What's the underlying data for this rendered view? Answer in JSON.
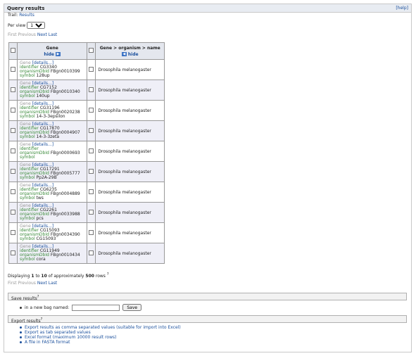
{
  "panel": {
    "title": "Query results",
    "help_label": "[help]"
  },
  "trail": {
    "prefix": "Trail:",
    "link": "Results"
  },
  "per_view": {
    "label": "Per view",
    "value": "10"
  },
  "pager": {
    "first": "First",
    "previous": "Previous",
    "next": "Next",
    "last": "Last"
  },
  "columns": {
    "gene": {
      "title": "Gene",
      "hide": "hide"
    },
    "organism": {
      "title": "Gene > organism > name",
      "hide": "hide"
    }
  },
  "rows": [
    {
      "cls": "Gene",
      "details": "[details...]",
      "identifier": "CG3340",
      "organism_db_id": "FBgn0010399",
      "symbol": "128up",
      "organism": "Drosophila melanogaster"
    },
    {
      "cls": "Gene",
      "details": "[details...]",
      "identifier": "CG7152",
      "organism_db_id": "FBgn0010340",
      "symbol": "140up",
      "organism": "Drosophila melanogaster"
    },
    {
      "cls": "Gene",
      "details": "[details...]",
      "identifier": "CG31196",
      "organism_db_id": "FBgn0020238",
      "symbol": "14-3-3epsilon",
      "organism": "Drosophila melanogaster"
    },
    {
      "cls": "Gene",
      "details": "[details...]",
      "identifier": "CG17870",
      "organism_db_id": "FBgn0004907",
      "symbol": "14-3-3zeta",
      "organism": "Drosophila melanogaster"
    },
    {
      "cls": "Gene",
      "details": "[details...]",
      "identifier": "",
      "organism_db_id": "FBgn0000693",
      "symbol": "",
      "organism": "Drosophila melanogaster"
    },
    {
      "cls": "Gene",
      "details": "[details...]",
      "identifier": "CG17291",
      "organism_db_id": "FBgn0005777",
      "symbol": "Pp2A-29B",
      "organism": "Drosophila melanogaster"
    },
    {
      "cls": "Gene",
      "details": "[details...]",
      "identifier": "CG6235",
      "organism_db_id": "FBgn0004889",
      "symbol": "tws",
      "organism": "Drosophila melanogaster"
    },
    {
      "cls": "Gene",
      "details": "[details...]",
      "identifier": "CG2261",
      "organism_db_id": "FBgn0033988",
      "symbol": "pcs",
      "organism": "Drosophila melanogaster"
    },
    {
      "cls": "Gene",
      "details": "[details...]",
      "identifier": "CG15093",
      "organism_db_id": "FBgn0034390",
      "symbol": "CG15093",
      "organism": "Drosophila melanogaster"
    },
    {
      "cls": "Gene",
      "details": "[details...]",
      "identifier": "CG11949",
      "organism_db_id": "FBgn0010434",
      "symbol": "cora",
      "organism": "Drosophila melanogaster"
    }
  ],
  "field_labels": {
    "identifier": "identifier",
    "organism_db_id": "organismDbId",
    "symbol": "symbol"
  },
  "displaying": {
    "prefix": "Displaying",
    "from": "1",
    "to_word": "to",
    "to": "10",
    "of_word": "of approximately",
    "total": "500",
    "suffix": "rows"
  },
  "save": {
    "title": "Save results",
    "option_label": "in a new bag named:",
    "input_placeholder": "",
    "button_label": "Save"
  },
  "export": {
    "title": "Export results",
    "items": [
      "Export results as comma separated values (suitable for import into Excel)",
      "Export as tab separated values",
      "Excel format (maximum 10000 result rows)",
      "A file in FASTA format"
    ]
  },
  "colors": {
    "link": "#1a4f9c",
    "field": "#3a8a3a",
    "header_bg": "#e4e7ee",
    "alt_row": "#efeff7"
  }
}
